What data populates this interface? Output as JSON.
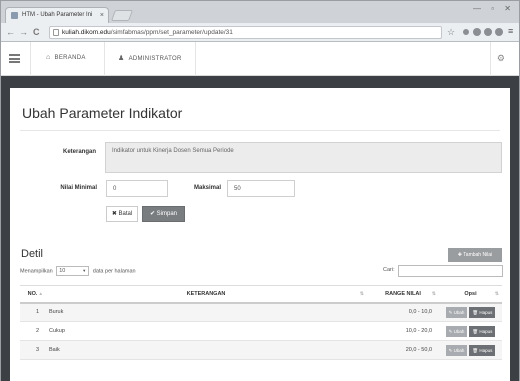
{
  "browser": {
    "tab_title": "HTM - Ubah Parameter Ini",
    "tab_close": "×",
    "window_controls": "— ▫ ✕",
    "url_host": "kuliah.dikom.edu",
    "url_path": "/simfabmas/ppm/set_parameter/update/31",
    "back": "←",
    "forward": "→",
    "reload": "C"
  },
  "navbar": {
    "items": [
      {
        "icon": "home-icon",
        "glyph": "⌂",
        "label": "BERANDA"
      },
      {
        "icon": "user-icon",
        "glyph": "♟",
        "label": "ADMINISTRATOR"
      }
    ],
    "settings_glyph": "⚙"
  },
  "page": {
    "title": "Ubah Parameter Indikator"
  },
  "form": {
    "keterangan_label": "Keterangan",
    "keterangan_value": "Indikator untuk Kinerja Dosen Semua Periode",
    "nilai_minimal_label": "Nilai Minimal",
    "nilai_minimal_value": "0",
    "maksimal_label": "Maksimal",
    "maksimal_value": "50",
    "batal_label": "✖ Batal",
    "simpan_label": "✔ Simpan"
  },
  "detil": {
    "title": "Detil",
    "tambah_label": "✚ Tambah Nilai",
    "length_prefix": "Menampilkan",
    "length_value": "10",
    "length_suffix": "data per halaman",
    "search_label": "Cari:",
    "columns": [
      "NO.",
      "KETERANGAN",
      "RANGE NILAI",
      "Opsi"
    ],
    "rows": [
      {
        "no": "1",
        "keterangan": "Buruk",
        "range": "0,0 - 10,0"
      },
      {
        "no": "2",
        "keterangan": "Cukup",
        "range": "10,0 - 20,0"
      },
      {
        "no": "3",
        "keterangan": "Baik",
        "range": "20,0 - 50,0"
      }
    ],
    "ubah_label": "✎ Ubah",
    "hapus_label": "🗑 Hapus"
  }
}
